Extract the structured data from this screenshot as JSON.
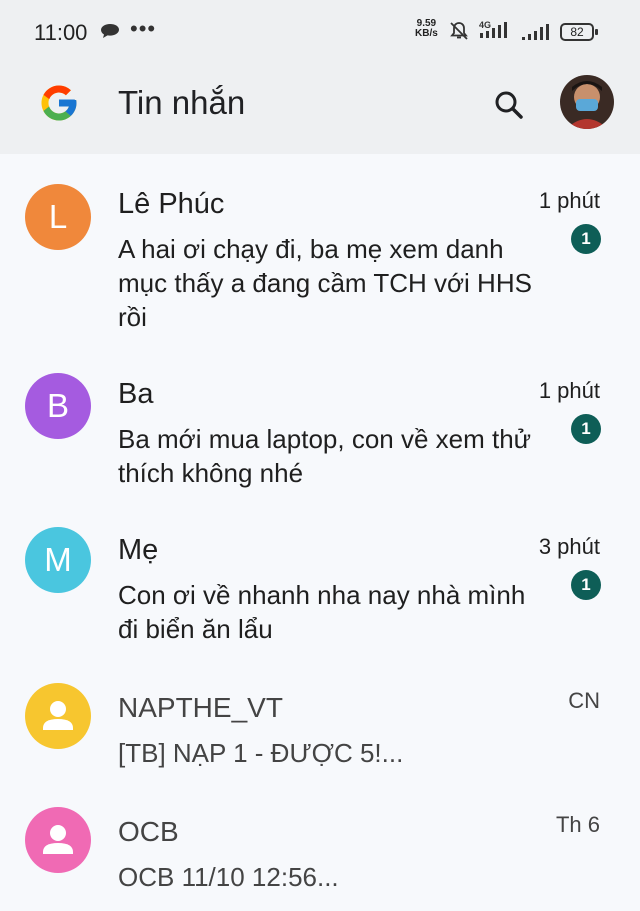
{
  "status_bar": {
    "time": "11:00",
    "dots": "•••",
    "speed_value": "9.59",
    "speed_unit": "KB/s",
    "network": "4G",
    "battery": "82"
  },
  "app_bar": {
    "title": "Tin nhắn",
    "logo_icon": "google-g-icon",
    "search_icon": "search-icon"
  },
  "conversations": [
    {
      "initial": "L",
      "name": "Lê Phúc",
      "snippet": "A hai ơi chạy đi, ba mẹ xem danh mục thấy a đang cầm TCH với HHS rồi",
      "time": "1 phút",
      "unread": "1",
      "avatar_color": "#f0883b"
    },
    {
      "initial": "B",
      "name": "Ba",
      "snippet": "Ba mới mua laptop, con về xem thử thích không nhé",
      "time": "1 phút",
      "unread": "1",
      "avatar_color": "#a55be0"
    },
    {
      "initial": "M",
      "name": "Mẹ",
      "snippet": "Con ơi về nhanh nha nay nhà mình đi biển ăn lẩu",
      "time": "3 phút",
      "unread": "1",
      "avatar_color": "#4ac6df"
    },
    {
      "initial": "",
      "name": "NAPTHE_VT",
      "snippet": "[TB] NẠP 1 - ĐƯỢC 5!...",
      "time": "CN",
      "avatar_color": "#f7c62f",
      "avatar_icon": "person-icon"
    },
    {
      "initial": "",
      "name": "OCB",
      "snippet": "OCB 11/10 12:56...",
      "time": "Th 6",
      "avatar_color": "#f06ab4",
      "avatar_icon": "person-icon"
    }
  ],
  "colors": {
    "header_bg": "#eef0f2",
    "list_bg": "#f7f9fc",
    "unread_badge": "#0e5e57"
  }
}
